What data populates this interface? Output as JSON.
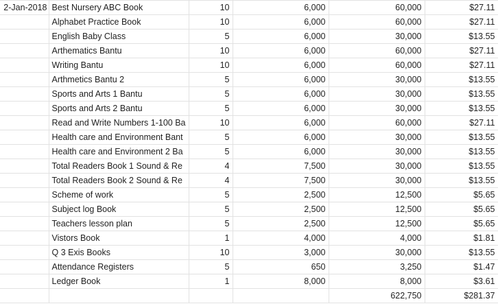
{
  "sheet": {
    "rows": [
      {
        "date": "2-Jan-2018",
        "item": "Best Nursery ABC Book",
        "qty": "10",
        "price": "6,000",
        "amount": "60,000",
        "usd": "$27.11"
      },
      {
        "date": "",
        "item": "Alphabet Practice Book",
        "qty": "10",
        "price": "6,000",
        "amount": "60,000",
        "usd": "$27.11"
      },
      {
        "date": "",
        "item": "English Baby Class",
        "qty": "5",
        "price": "6,000",
        "amount": "30,000",
        "usd": "$13.55"
      },
      {
        "date": "",
        "item": "Arthematics Bantu",
        "qty": "10",
        "price": "6,000",
        "amount": "60,000",
        "usd": "$27.11"
      },
      {
        "date": "",
        "item": "Writing Bantu",
        "qty": "10",
        "price": "6,000",
        "amount": "60,000",
        "usd": "$27.11"
      },
      {
        "date": "",
        "item": "Arthmetics Bantu 2",
        "qty": "5",
        "price": "6,000",
        "amount": "30,000",
        "usd": "$13.55"
      },
      {
        "date": "",
        "item": "Sports and  Arts 1 Bantu",
        "qty": "5",
        "price": "6,000",
        "amount": "30,000",
        "usd": "$13.55"
      },
      {
        "date": "",
        "item": "Sports and  Arts 2 Bantu",
        "qty": "5",
        "price": "6,000",
        "amount": "30,000",
        "usd": "$13.55"
      },
      {
        "date": "",
        "item": "Read and Write Numbers 1-100 Ba",
        "qty": "10",
        "price": "6,000",
        "amount": "60,000",
        "usd": "$27.11"
      },
      {
        "date": "",
        "item": "Health care and Environment Bant",
        "qty": "5",
        "price": "6,000",
        "amount": "30,000",
        "usd": "$13.55"
      },
      {
        "date": "",
        "item": "Health care and Environment 2 Ba",
        "qty": "5",
        "price": "6,000",
        "amount": "30,000",
        "usd": "$13.55"
      },
      {
        "date": "",
        "item": "Total Readers Book 1 Sound & Re",
        "qty": "4",
        "price": "7,500",
        "amount": "30,000",
        "usd": "$13.55"
      },
      {
        "date": "",
        "item": "Total Readers Book 2 Sound & Re",
        "qty": "4",
        "price": "7,500",
        "amount": "30,000",
        "usd": "$13.55"
      },
      {
        "date": "",
        "item": "Scheme of work",
        "qty": "5",
        "price": "2,500",
        "amount": "12,500",
        "usd": "$5.65"
      },
      {
        "date": "",
        "item": "Subject log Book",
        "qty": "5",
        "price": "2,500",
        "amount": "12,500",
        "usd": "$5.65"
      },
      {
        "date": "",
        "item": "Teachers lesson plan",
        "qty": "5",
        "price": "2,500",
        "amount": "12,500",
        "usd": "$5.65"
      },
      {
        "date": "",
        "item": "Vistors Book",
        "qty": "1",
        "price": "4,000",
        "amount": "4,000",
        "usd": "$1.81"
      },
      {
        "date": "",
        "item": "Q 3 Exis Books",
        "qty": "10",
        "price": "3,000",
        "amount": "30,000",
        "usd": "$13.55"
      },
      {
        "date": "",
        "item": "Attendance Registers",
        "qty": "5",
        "price": "650",
        "amount": "3,250",
        "usd": "$1.47"
      },
      {
        "date": "",
        "item": "Ledger Book",
        "qty": "1",
        "price": "8,000",
        "amount": "8,000",
        "usd": "$3.61"
      }
    ],
    "total": {
      "amount": "622,750",
      "usd": "$281.37"
    }
  }
}
